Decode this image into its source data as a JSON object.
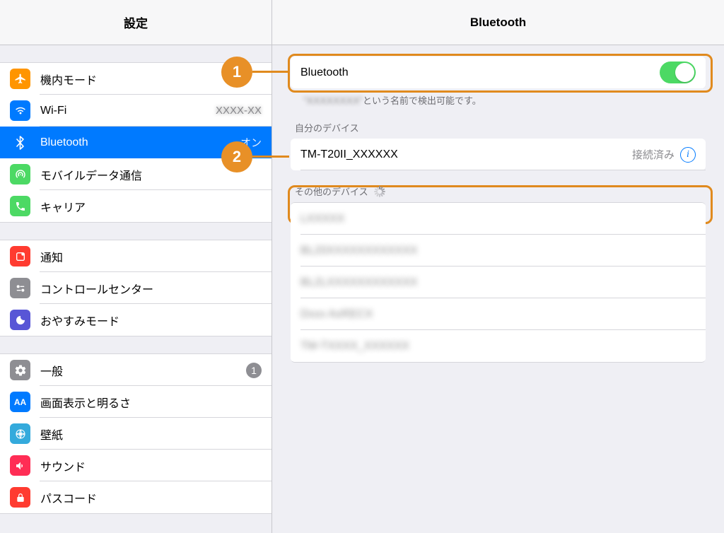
{
  "sidebar": {
    "title": "設定",
    "groups": [
      [
        {
          "key": "airplane",
          "label": "機内モード"
        },
        {
          "key": "wifi",
          "label": "Wi-Fi",
          "value_blurred": true,
          "value": "XXXX-XX"
        },
        {
          "key": "bluetooth",
          "label": "Bluetooth",
          "value": "オン",
          "selected": true
        },
        {
          "key": "cellular",
          "label": "モバイルデータ通信"
        },
        {
          "key": "carrier",
          "label": "キャリア"
        }
      ],
      [
        {
          "key": "notifications",
          "label": "通知"
        },
        {
          "key": "control-center",
          "label": "コントロールセンター"
        },
        {
          "key": "dnd",
          "label": "おやすみモード"
        }
      ],
      [
        {
          "key": "general",
          "label": "一般",
          "badge": "1"
        },
        {
          "key": "display",
          "label": "画面表示と明るさ"
        },
        {
          "key": "wallpaper",
          "label": "壁紙"
        },
        {
          "key": "sounds",
          "label": "サウンド"
        },
        {
          "key": "passcode",
          "label": "パスコード"
        }
      ]
    ]
  },
  "detail": {
    "title": "Bluetooth",
    "toggle": {
      "label": "Bluetooth",
      "on": true
    },
    "discoverable_suffix": "という名前で検出可能です。",
    "my_devices_header": "自分のデバイス",
    "my_devices": [
      {
        "name": "TM-T20II_XXXXXX",
        "status": "接続済み"
      }
    ],
    "other_devices_header": "その他のデバイス",
    "other_devices_blurred_count": 5
  },
  "callouts": {
    "1": "1",
    "2": "2"
  },
  "colors": {
    "accent": "#007aff",
    "callout": "#e08a1e",
    "toggle_on": "#4cd964"
  }
}
